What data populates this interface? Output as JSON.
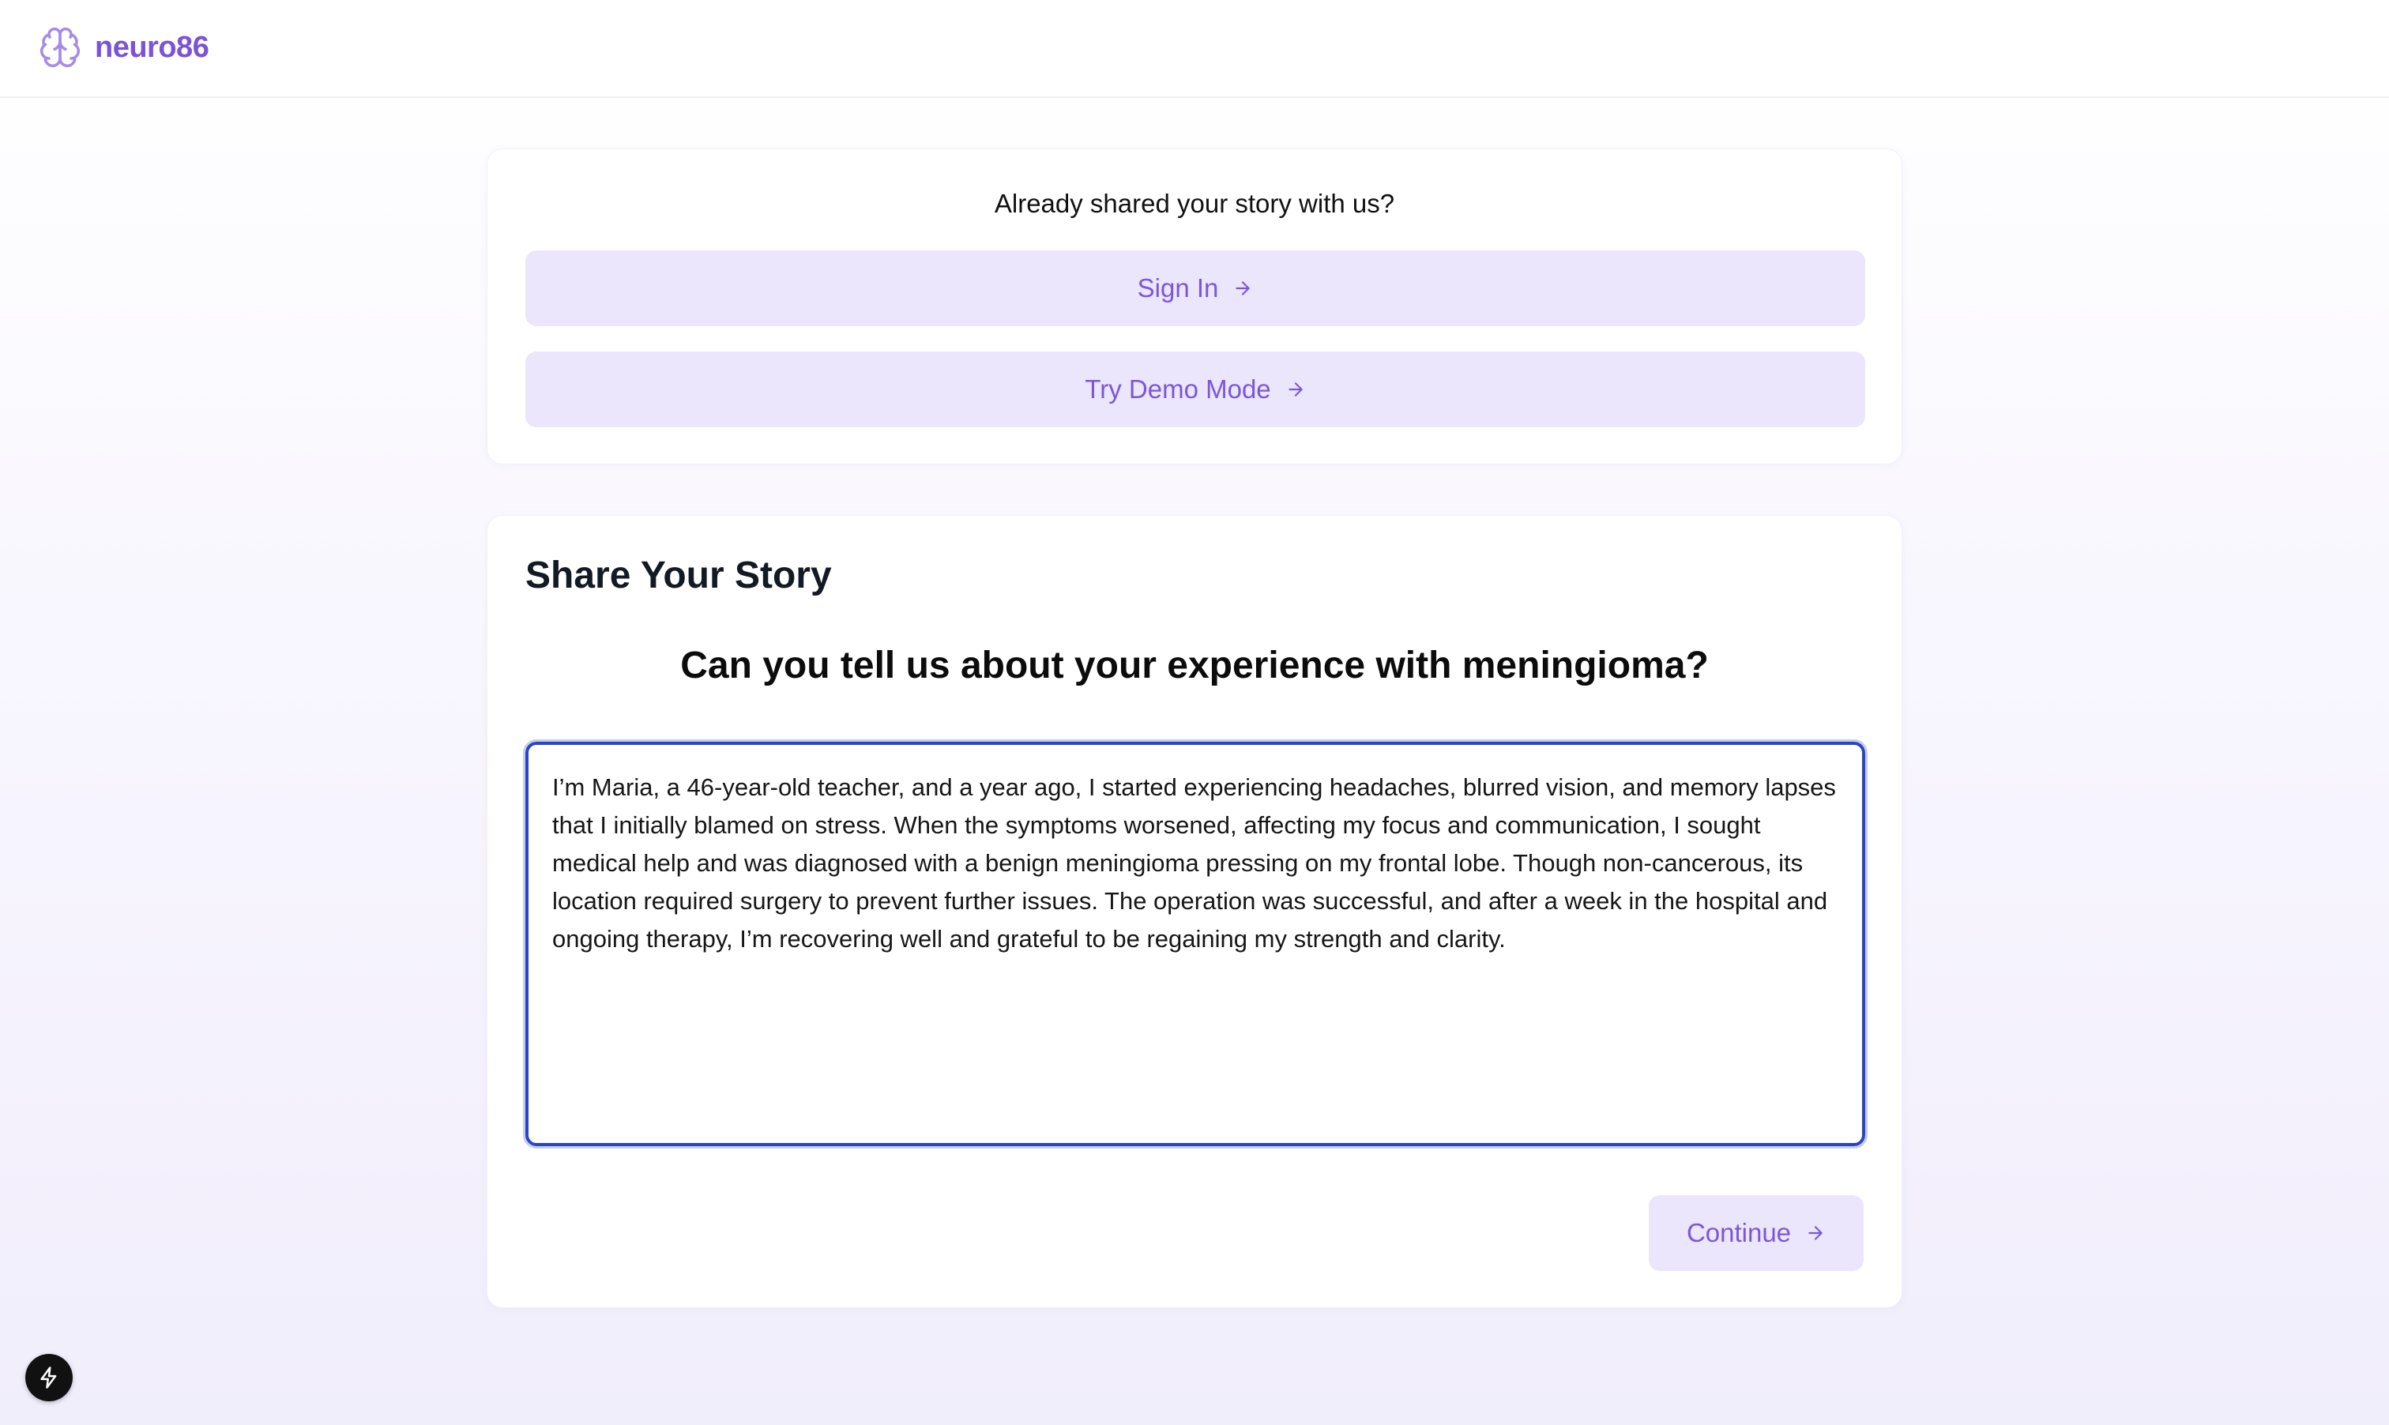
{
  "brand": {
    "name": "neuro86",
    "icon": "brain-icon",
    "color": "#7b52d8"
  },
  "signin_card": {
    "prompt": "Already shared your story with us?",
    "signin_label": "Sign In",
    "demo_label": "Try Demo Mode",
    "arrow_icon": "arrow-right-icon"
  },
  "story_card": {
    "heading": "Share Your Story",
    "question": "Can you tell us about your experience with meningioma?",
    "story_value": "I’m Maria, a 46-year-old teacher, and a year ago, I started experiencing headaches, blurred vision, and memory lapses that I initially blamed on stress. When the symptoms worsened, affecting my focus and communication, I sought medical help and was diagnosed with a benign meningioma pressing on my frontal lobe. Though non-cancerous, its location required surgery to prevent further issues. The operation was successful, and after a week in the hospital and ongoing therapy, I’m recovering well and grateful to be regaining my strength and clarity.",
    "continue_label": "Continue"
  },
  "dev_tools": {
    "icon": "lightning-bolt-icon"
  },
  "colors": {
    "accent": "#7b57d6",
    "button_bg": "#ebe6fb",
    "focus_border": "#2a44c2"
  }
}
